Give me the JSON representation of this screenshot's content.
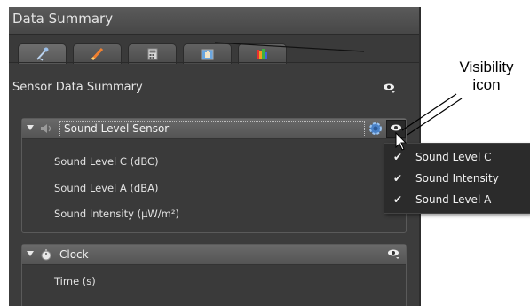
{
  "panel": {
    "title": "Data Summary",
    "tabs": [
      {
        "icon": "probe-icon",
        "active": true
      },
      {
        "icon": "pencil-icon",
        "active": false
      },
      {
        "icon": "calculator-icon",
        "active": false
      },
      {
        "icon": "graph-hand-icon",
        "active": false
      },
      {
        "icon": "spectrum-icon",
        "active": false
      }
    ],
    "section_title": "Sensor Data Summary"
  },
  "sensor": {
    "name": "Sound Level Sensor",
    "rows": [
      "Sound Level C (dBC)",
      "Sound Level A (dBA)",
      "Sound Intensity (µW/m²)"
    ]
  },
  "clock": {
    "name": "Clock",
    "rows": [
      "Time (s)"
    ]
  },
  "visibility_menu": {
    "items": [
      {
        "label": "Sound Level C",
        "checked": true
      },
      {
        "label": "Sound Intensity",
        "checked": true
      },
      {
        "label": "Sound Level A",
        "checked": true
      }
    ],
    "check_glyph": "✔"
  },
  "annotation": {
    "line1": "Visibility",
    "line2": "icon"
  },
  "colors": {
    "panel_bg": "#3c3c3c",
    "header_bg": "#5e5e5e",
    "menu_bg": "#2b2b2b",
    "text": "#e6e6e6"
  }
}
